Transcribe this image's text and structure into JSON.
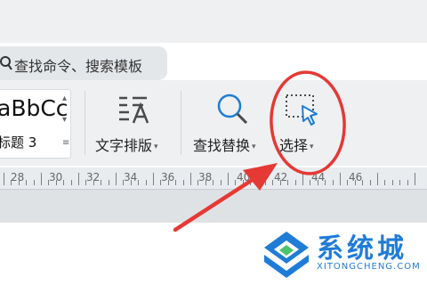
{
  "search": {
    "text": "查找命令、搜索模板"
  },
  "styles": {
    "sample_text": "aBbCc",
    "current_style": "标题 3"
  },
  "toolbar": {
    "text_layout_label": "文字排版",
    "find_replace_label": "查找替换",
    "select_label": "选择"
  },
  "ruler": {
    "labels": [
      "28",
      "30",
      "32",
      "34",
      "36",
      "38",
      "40",
      "42",
      "44",
      "46"
    ]
  },
  "annotation": {
    "highlight_color": "#e53935",
    "arrow_color": "#e53935"
  },
  "watermark": {
    "name": "系统城",
    "url": "XITONGCHENG.COM"
  },
  "colors": {
    "accent": "#1f7cd6",
    "ribbon_bg": "#eef0f2"
  }
}
